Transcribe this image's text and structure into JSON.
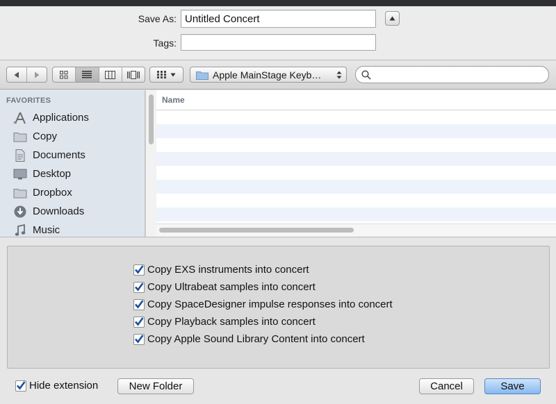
{
  "save_as": {
    "label": "Save As:",
    "value": "Untitled Concert"
  },
  "tags": {
    "label": "Tags:",
    "value": ""
  },
  "toolbar": {
    "back_icon": "back-triangle",
    "forward_icon": "forward-triangle",
    "view_modes": [
      "icon-view",
      "list-view",
      "column-view",
      "coverflow-view"
    ],
    "arrange_icon": "arrange-grid",
    "location": "Apple MainStage Keyb…",
    "search_placeholder": ""
  },
  "sidebar": {
    "header": "FAVORITES",
    "items": [
      {
        "label": "Applications",
        "icon": "applications"
      },
      {
        "label": "Copy",
        "icon": "folder"
      },
      {
        "label": "Documents",
        "icon": "documents"
      },
      {
        "label": "Desktop",
        "icon": "desktop"
      },
      {
        "label": "Dropbox",
        "icon": "folder"
      },
      {
        "label": "Downloads",
        "icon": "downloads"
      },
      {
        "label": "Music",
        "icon": "music"
      }
    ]
  },
  "file_list": {
    "column_name": "Name"
  },
  "options": [
    {
      "label": "Copy EXS instruments into concert",
      "checked": true
    },
    {
      "label": "Copy Ultrabeat samples into concert",
      "checked": true
    },
    {
      "label": "Copy SpaceDesigner impulse responses into concert",
      "checked": true
    },
    {
      "label": "Copy Playback samples into concert",
      "checked": true
    },
    {
      "label": "Copy Apple Sound Library Content into concert",
      "checked": true
    }
  ],
  "footer": {
    "hide_extension": {
      "label": "Hide extension",
      "checked": true
    },
    "new_folder": "New Folder",
    "cancel": "Cancel",
    "save": "Save"
  },
  "colors": {
    "accent": "#86b8ef",
    "sidebar_bg": "#dfe5ed",
    "checkmark": "#1c4f9a"
  }
}
